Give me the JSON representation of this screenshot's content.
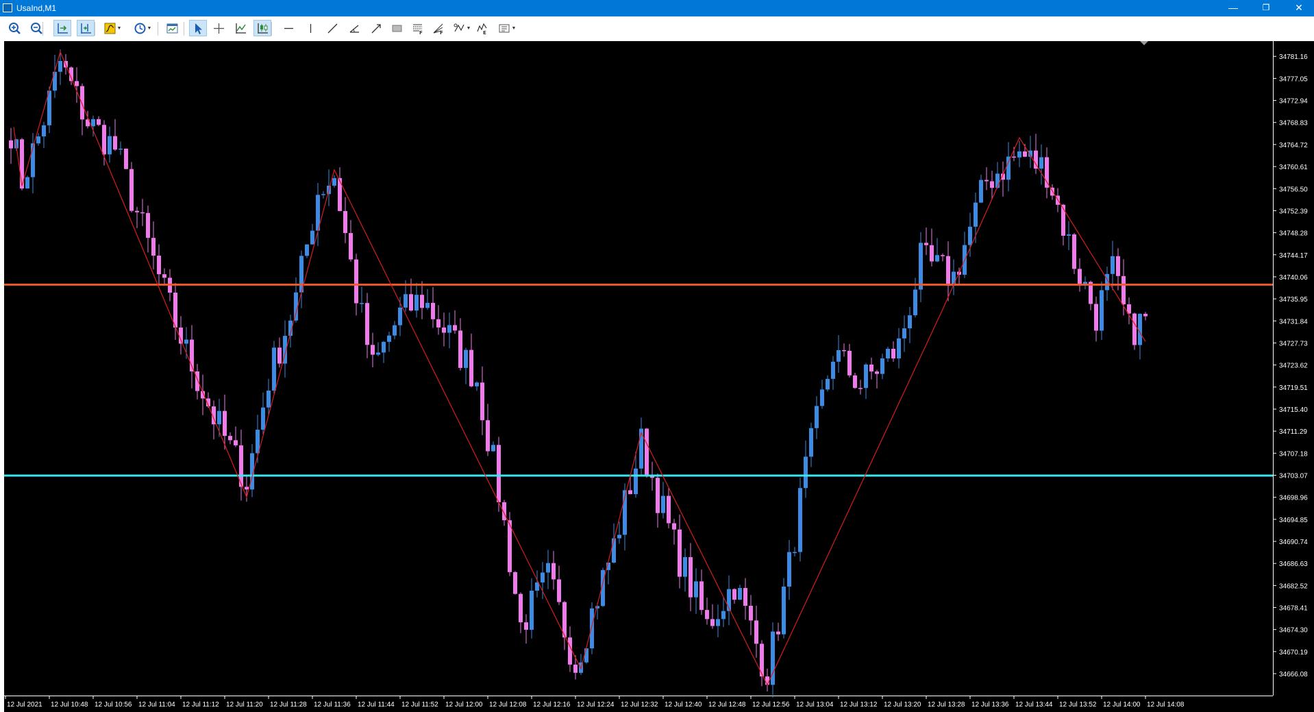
{
  "window": {
    "title": "UsaInd,M1",
    "minimize_glyph": "—",
    "restore_glyph": "❐",
    "close_glyph": "✕"
  },
  "toolbar": {
    "items": [
      {
        "name": "zoom-in-icon",
        "group": "view"
      },
      {
        "name": "zoom-out-icon",
        "group": "view"
      },
      {
        "name": "chart-shift-icon",
        "group": "view",
        "active": true
      },
      {
        "name": "autoscroll-icon",
        "group": "view",
        "active": true
      },
      {
        "name": "indicators-icon",
        "group": "tools",
        "dropdown": true
      },
      {
        "name": "periods-clock-icon",
        "group": "tools",
        "dropdown": true
      },
      {
        "name": "templates-icon",
        "group": "tools"
      },
      {
        "name": "cursor-icon",
        "group": "draw",
        "active": true
      },
      {
        "name": "crosshair-icon",
        "group": "draw"
      },
      {
        "name": "line-chart-icon",
        "group": "draw"
      },
      {
        "name": "candlesticks-icon",
        "group": "draw",
        "active": true
      },
      {
        "name": "horizontal-line-icon",
        "group": "objects"
      },
      {
        "name": "vertical-line-icon",
        "group": "objects"
      },
      {
        "name": "trend-line-icon",
        "group": "objects"
      },
      {
        "name": "angle-line-icon",
        "group": "objects"
      },
      {
        "name": "arrow-line-icon",
        "group": "objects"
      },
      {
        "name": "rectangle-icon",
        "group": "objects"
      },
      {
        "name": "fibonacci-retracement-icon",
        "group": "objects"
      },
      {
        "name": "fibonacci-fan-icon",
        "group": "objects"
      },
      {
        "name": "shapes-icon",
        "group": "objects",
        "dropdown": true
      },
      {
        "name": "elliott-waves-icon",
        "group": "objects"
      },
      {
        "name": "objects-list-icon",
        "group": "objects",
        "dropdown": true
      }
    ]
  },
  "chart_data": {
    "type": "candlestick",
    "symbol": "UsaInd",
    "timeframe": "M1",
    "colors": {
      "background": "#000000",
      "bull": "#3c8ce6",
      "bear": "#f07aeb",
      "zigzag": "#d81c1c",
      "resistance_line": "#f05a28",
      "support_line": "#3ce6f0",
      "axis_text": "#ffffff"
    },
    "ylim": [
      34662.0,
      34784.0
    ],
    "y_ticks": [
      "34781.16",
      "34777.05",
      "34772.94",
      "34768.83",
      "34764.72",
      "34760.61",
      "34756.50",
      "34752.39",
      "34748.28",
      "34744.17",
      "34740.06",
      "34735.95",
      "34731.84",
      "34727.73",
      "34723.62",
      "34719.51",
      "34715.40",
      "34711.29",
      "34707.18",
      "34703.07",
      "34698.96",
      "34694.85",
      "34690.74",
      "34686.63",
      "34682.52",
      "34678.41",
      "34674.30",
      "34670.19",
      "34666.08"
    ],
    "x_ticks": [
      {
        "bar": 0,
        "label": "12 Jul 2021"
      },
      {
        "bar": 8,
        "label": "12 Jul 10:48"
      },
      {
        "bar": 16,
        "label": "12 Jul 10:56"
      },
      {
        "bar": 24,
        "label": "12 Jul 11:04"
      },
      {
        "bar": 32,
        "label": "12 Jul 11:12"
      },
      {
        "bar": 40,
        "label": "12 Jul 11:20"
      },
      {
        "bar": 48,
        "label": "12 Jul 11:28"
      },
      {
        "bar": 56,
        "label": "12 Jul 11:36"
      },
      {
        "bar": 64,
        "label": "12 Jul 11:44"
      },
      {
        "bar": 72,
        "label": "12 Jul 11:52"
      },
      {
        "bar": 80,
        "label": "12 Jul 12:00"
      },
      {
        "bar": 88,
        "label": "12 Jul 12:08"
      },
      {
        "bar": 96,
        "label": "12 Jul 12:16"
      },
      {
        "bar": 104,
        "label": "12 Jul 12:24"
      },
      {
        "bar": 112,
        "label": "12 Jul 12:32"
      },
      {
        "bar": 120,
        "label": "12 Jul 12:40"
      },
      {
        "bar": 128,
        "label": "12 Jul 12:48"
      },
      {
        "bar": 136,
        "label": "12 Jul 12:56"
      },
      {
        "bar": 144,
        "label": "12 Jul 13:04"
      },
      {
        "bar": 152,
        "label": "12 Jul 13:12"
      },
      {
        "bar": 160,
        "label": "12 Jul 13:20"
      },
      {
        "bar": 168,
        "label": "12 Jul 13:28"
      },
      {
        "bar": 176,
        "label": "12 Jul 13:36"
      },
      {
        "bar": 184,
        "label": "12 Jul 13:44"
      },
      {
        "bar": 192,
        "label": "12 Jul 13:52"
      },
      {
        "bar": 200,
        "label": "12 Jul 14:00"
      },
      {
        "bar": 208,
        "label": "12 Jul 14:08"
      }
    ],
    "bar_count": 208,
    "horizontal_lines": [
      {
        "name": "resistance",
        "value": 34738.6
      },
      {
        "name": "support",
        "value": 34703.0
      }
    ],
    "anchors": [
      {
        "bar": 0,
        "price": 34767.5
      },
      {
        "bar": 2,
        "price": 34758
      },
      {
        "bar": 5,
        "price": 34766
      },
      {
        "bar": 9,
        "price": 34780
      },
      {
        "bar": 14,
        "price": 34769
      },
      {
        "bar": 19,
        "price": 34764
      },
      {
        "bar": 23,
        "price": 34752
      },
      {
        "bar": 28,
        "price": 34737
      },
      {
        "bar": 32,
        "price": 34726
      },
      {
        "bar": 37,
        "price": 34714
      },
      {
        "bar": 43,
        "price": 34702
      },
      {
        "bar": 47,
        "price": 34721
      },
      {
        "bar": 52,
        "price": 34736
      },
      {
        "bar": 56,
        "price": 34756
      },
      {
        "bar": 59,
        "price": 34759
      },
      {
        "bar": 63,
        "price": 34737
      },
      {
        "bar": 66,
        "price": 34723
      },
      {
        "bar": 71,
        "price": 34733
      },
      {
        "bar": 75,
        "price": 34736
      },
      {
        "bar": 80,
        "price": 34729
      },
      {
        "bar": 85,
        "price": 34721
      },
      {
        "bar": 89,
        "price": 34700
      },
      {
        "bar": 93,
        "price": 34675
      },
      {
        "bar": 98,
        "price": 34684
      },
      {
        "bar": 103,
        "price": 34668
      },
      {
        "bar": 110,
        "price": 34690
      },
      {
        "bar": 115,
        "price": 34709
      },
      {
        "bar": 121,
        "price": 34690
      },
      {
        "bar": 127,
        "price": 34675
      },
      {
        "bar": 132,
        "price": 34683
      },
      {
        "bar": 138,
        "price": 34666
      },
      {
        "bar": 142,
        "price": 34686
      },
      {
        "bar": 145,
        "price": 34704
      },
      {
        "bar": 150,
        "price": 34726
      },
      {
        "bar": 155,
        "price": 34720
      },
      {
        "bar": 162,
        "price": 34727
      },
      {
        "bar": 166,
        "price": 34743
      },
      {
        "bar": 172,
        "price": 34740
      },
      {
        "bar": 178,
        "price": 34758
      },
      {
        "bar": 184,
        "price": 34763
      },
      {
        "bar": 189,
        "price": 34760
      },
      {
        "bar": 194,
        "price": 34743
      },
      {
        "bar": 198,
        "price": 34733
      },
      {
        "bar": 201,
        "price": 34741
      },
      {
        "bar": 204,
        "price": 34730
      },
      {
        "bar": 207,
        "price": 34732
      }
    ],
    "zigzag": [
      {
        "bar": 0.5,
        "price": 34768
      },
      {
        "bar": 2,
        "price": 34757
      },
      {
        "bar": 9,
        "price": 34782
      },
      {
        "bar": 43,
        "price": 34699
      },
      {
        "bar": 59,
        "price": 34760
      },
      {
        "bar": 104,
        "price": 34667
      },
      {
        "bar": 115,
        "price": 34711
      },
      {
        "bar": 138,
        "price": 34664
      },
      {
        "bar": 170,
        "price": 34734
      },
      {
        "bar": 184,
        "price": 34766
      },
      {
        "bar": 207,
        "price": 34728
      }
    ]
  }
}
